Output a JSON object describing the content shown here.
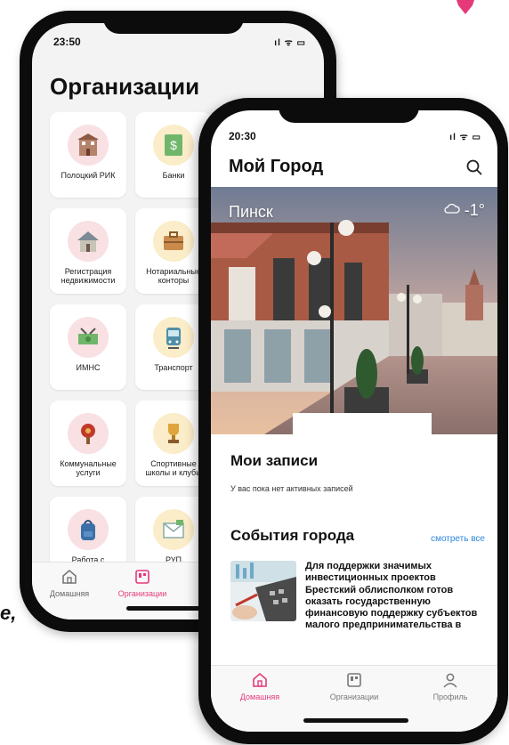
{
  "decor": {
    "stray_text": "е,",
    "pink_color": "#e6397a"
  },
  "phone_back": {
    "status": {
      "time": "23:50",
      "icons": "ıl ᯤ ▭"
    },
    "title": "Организации",
    "tiles": [
      {
        "label": "Полоцкий РИК",
        "icon": "building-icon",
        "color": "#f9e0e3"
      },
      {
        "label": "Банки",
        "icon": "bank-icon",
        "color": "#fbedc9"
      },
      {
        "label": "Регистрация\nнедвижимости",
        "icon": "house-icon",
        "color": "#f9e0e3"
      },
      {
        "label": "Нотариальные\nконторы",
        "icon": "briefcase-icon",
        "color": "#fbedc9"
      },
      {
        "label": "ИМНС",
        "icon": "money-icon",
        "color": "#f9e0e3"
      },
      {
        "label": "Транспорт",
        "icon": "tram-icon",
        "color": "#fbedc9"
      },
      {
        "label": "Коммунальные\nуслуги",
        "icon": "pin-icon",
        "color": "#f9e0e3"
      },
      {
        "label": "Спортивные\nшколы и клубы",
        "icon": "trophy-icon",
        "color": "#fbedc9"
      },
      {
        "label": "Работа с\nмолодёжью",
        "icon": "backpack-icon",
        "color": "#f9e0e3"
      },
      {
        "label": "РУП\n«Белпочта»",
        "icon": "mail-icon",
        "color": "#fbedc9"
      }
    ],
    "tabs": [
      {
        "label": "Домашняя",
        "icon": "home-icon",
        "active": false
      },
      {
        "label": "Организации",
        "icon": "org-icon",
        "active": true
      }
    ],
    "active_color": "#e6397a"
  },
  "phone_front": {
    "status": {
      "time": "20:30",
      "icons": "ıl ᯤ ▭"
    },
    "title": "Мой Город",
    "hero": {
      "city": "Пинск",
      "temperature": "-1°",
      "weather_icon": "cloud-icon"
    },
    "records": {
      "title": "Мои записи",
      "empty_text": "У вас пока нет активных записей"
    },
    "events": {
      "title": "События города",
      "see_all": "смотреть все",
      "items": [
        {
          "text": "Для поддержки значимых инвестиционных проектов Брестский облисполком готов оказать государственную финансовую поддержку субъектов малого предпринимательства в"
        }
      ]
    },
    "tabs": [
      {
        "label": "Домашняя",
        "icon": "home-icon",
        "active": true
      },
      {
        "label": "Организации",
        "icon": "org-icon",
        "active": false
      },
      {
        "label": "Профиль",
        "icon": "profile-icon",
        "active": false
      }
    ],
    "active_color": "#e6397a",
    "link_color": "#2e86de"
  }
}
